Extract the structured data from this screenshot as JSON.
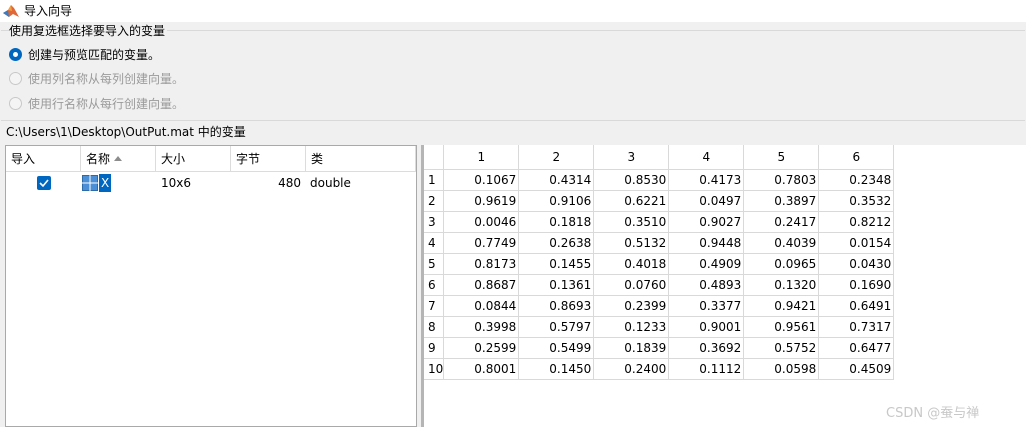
{
  "window": {
    "title": "导入向导"
  },
  "options": {
    "group_title": "使用复选框选择要导入的变量",
    "radios": [
      {
        "label": "创建与预览匹配的变量。",
        "selected": true,
        "enabled": true
      },
      {
        "label": "使用列名称从每列创建向量。",
        "selected": false,
        "enabled": false
      },
      {
        "label": "使用行名称从每行创建向量。",
        "selected": false,
        "enabled": false
      }
    ]
  },
  "variables_caption": "C:\\Users\\1\\Desktop\\OutPut.mat 中的变量",
  "var_table": {
    "headers": {
      "import": "导入",
      "name": "名称",
      "size": "大小",
      "bytes": "字节",
      "class": "类"
    },
    "row": {
      "checked": true,
      "name": "X",
      "size": "10x6",
      "bytes": "480",
      "class": "double"
    }
  },
  "preview": {
    "columns": [
      "1",
      "2",
      "3",
      "4",
      "5",
      "6"
    ],
    "rows": [
      {
        "index": "1",
        "cells": [
          "0.1067",
          "0.4314",
          "0.8530",
          "0.4173",
          "0.7803",
          "0.2348"
        ]
      },
      {
        "index": "2",
        "cells": [
          "0.9619",
          "0.9106",
          "0.6221",
          "0.0497",
          "0.3897",
          "0.3532"
        ]
      },
      {
        "index": "3",
        "cells": [
          "0.0046",
          "0.1818",
          "0.3510",
          "0.9027",
          "0.2417",
          "0.8212"
        ]
      },
      {
        "index": "4",
        "cells": [
          "0.7749",
          "0.2638",
          "0.5132",
          "0.9448",
          "0.4039",
          "0.0154"
        ]
      },
      {
        "index": "5",
        "cells": [
          "0.8173",
          "0.1455",
          "0.4018",
          "0.4909",
          "0.0965",
          "0.0430"
        ]
      },
      {
        "index": "6",
        "cells": [
          "0.8687",
          "0.1361",
          "0.0760",
          "0.4893",
          "0.1320",
          "0.1690"
        ]
      },
      {
        "index": "7",
        "cells": [
          "0.0844",
          "0.8693",
          "0.2399",
          "0.3377",
          "0.9421",
          "0.6491"
        ]
      },
      {
        "index": "8",
        "cells": [
          "0.3998",
          "0.5797",
          "0.1233",
          "0.9001",
          "0.9561",
          "0.7317"
        ]
      },
      {
        "index": "9",
        "cells": [
          "0.2599",
          "0.5499",
          "0.1839",
          "0.3692",
          "0.5752",
          "0.6477"
        ]
      },
      {
        "index": "10",
        "cells": [
          "0.8001",
          "0.1450",
          "0.2400",
          "0.1112",
          "0.0598",
          "0.4509"
        ]
      }
    ]
  },
  "watermark": "CSDN @蚕与禅",
  "colors": {
    "accent": "#0067c0",
    "background": "#f0f0f0"
  },
  "icons": {
    "app": "matlab-logo-icon",
    "variable": "matrix-variable-icon",
    "sort": "sort-ascending-icon"
  }
}
